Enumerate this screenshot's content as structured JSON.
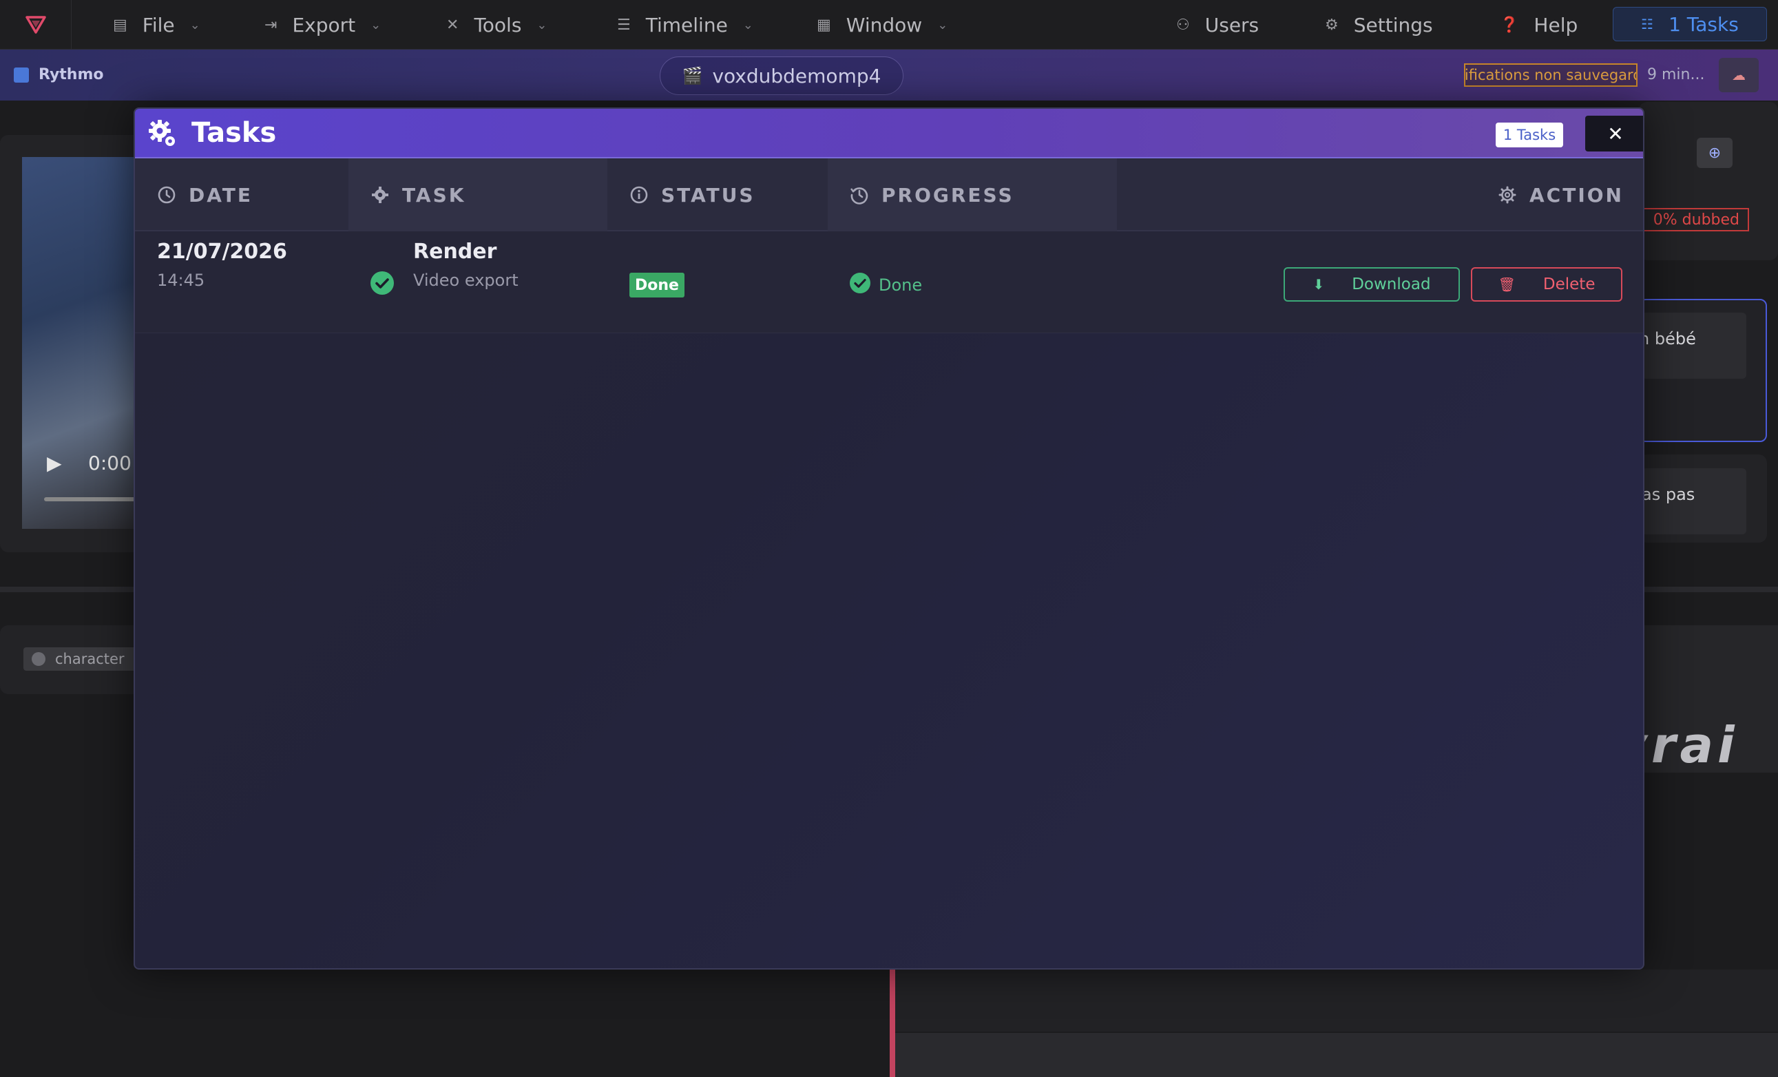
{
  "menubar": {
    "items": [
      {
        "label": "File",
        "icon": "file-icon"
      },
      {
        "label": "Export",
        "icon": "export-icon"
      },
      {
        "label": "Tools",
        "icon": "tools-icon"
      },
      {
        "label": "Timeline",
        "icon": "timeline-icon"
      },
      {
        "label": "Window",
        "icon": "window-icon"
      }
    ],
    "right": [
      {
        "label": "Users",
        "icon": "users-icon"
      },
      {
        "label": "Settings",
        "icon": "gear-icon"
      },
      {
        "label": "Help",
        "icon": "help-icon"
      }
    ],
    "tasks_button": "1 Tasks"
  },
  "projectbar": {
    "brand": "Rythmo",
    "filename": "voxdubdemomp4",
    "unsaved": "Modifications non sauvegardées",
    "save_time": "9 min..."
  },
  "background": {
    "video_time": "0:00 /",
    "character_label": "character",
    "dubbed_label": "0% dubbed",
    "line1_fragment": "n bébé",
    "line2_fragment": "as pas",
    "timeline_word": "vrai"
  },
  "modal": {
    "title": "Tasks",
    "badge": "1 Tasks",
    "close_glyph": "✕",
    "columns": {
      "date": "DATE",
      "task": "TASK",
      "status": "STATUS",
      "progress": "PROGRESS",
      "action": "ACTION"
    },
    "rows": [
      {
        "date": "21/07/2026",
        "time": "14:45",
        "task": "Render",
        "task_sub": "Video export",
        "status": "Done",
        "progress": "Done",
        "download_label": "Download",
        "delete_label": "Delete"
      }
    ]
  },
  "colors": {
    "accent": "#5a44cc",
    "success": "#3aa864",
    "danger": "#d84a5a"
  }
}
